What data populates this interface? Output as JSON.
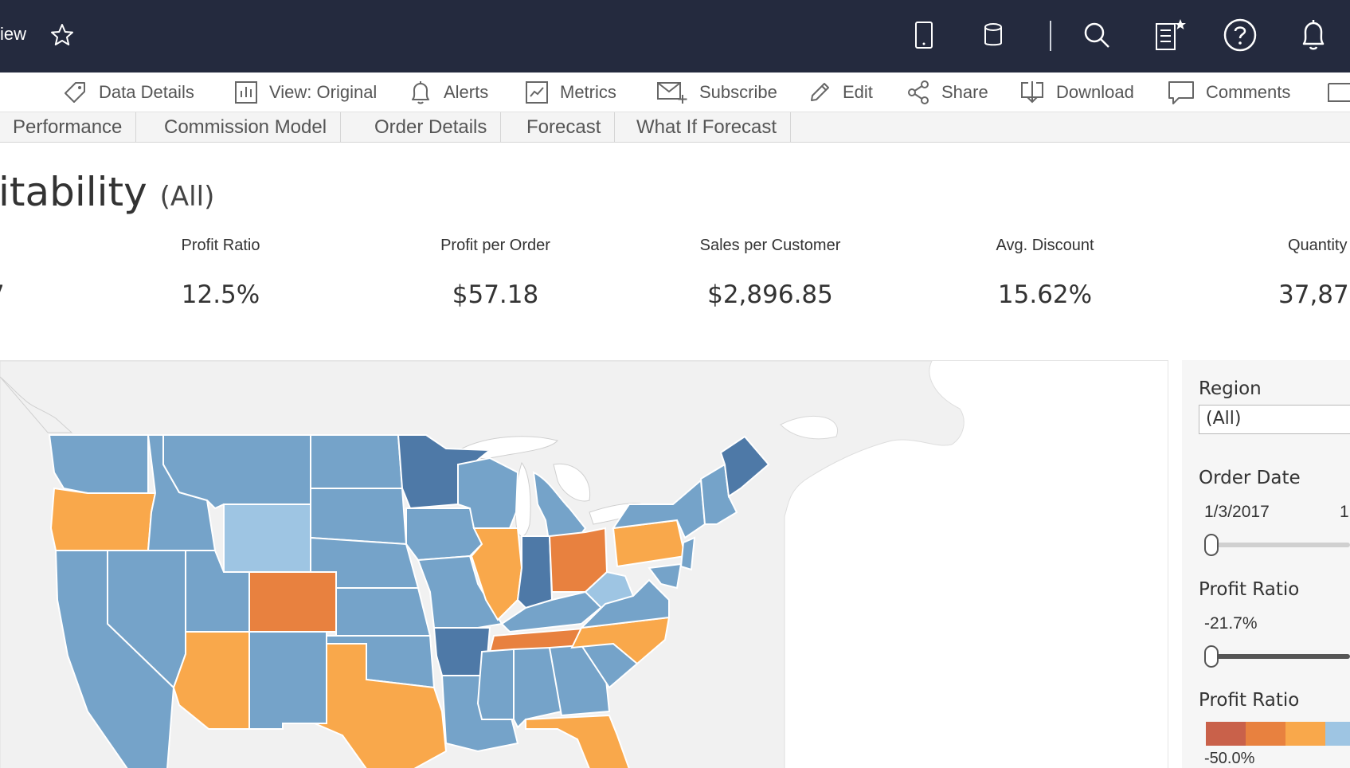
{
  "app": {
    "title_fragment": "iew"
  },
  "toolbar": {
    "items": [
      {
        "label": "Data Details",
        "icon": "tag-icon"
      },
      {
        "label": "View: Original",
        "icon": "bar-chart-icon"
      },
      {
        "label": "Alerts",
        "icon": "bell-icon"
      },
      {
        "label": "Metrics",
        "icon": "metrics-icon"
      },
      {
        "label": "Subscribe",
        "icon": "mail-plus-icon"
      },
      {
        "label": "Edit",
        "icon": "pencil-icon"
      },
      {
        "label": "Share",
        "icon": "share-icon"
      },
      {
        "label": "Download",
        "icon": "download-icon"
      },
      {
        "label": "Comments",
        "icon": "comment-icon"
      }
    ]
  },
  "tabs": [
    "Performance",
    "Commission Model",
    "Order Details",
    "Forecast",
    "What If Forecast"
  ],
  "dashboard": {
    "title": "itability",
    "title_suffix": "(All)"
  },
  "kpis": [
    {
      "label": "Profit Ratio",
      "value": "12.5%"
    },
    {
      "label": "Profit per Order",
      "value": "$57.18"
    },
    {
      "label": "Sales per Customer",
      "value": "$2,896.85"
    },
    {
      "label": "Avg. Discount",
      "value": "15.62%"
    }
  ],
  "kpi_left_value_fragment": "7",
  "kpi_edge": {
    "label": "Quantity",
    "value": "37,87"
  },
  "filters": {
    "region_title": "Region",
    "region_value": "(All)",
    "order_date_title": "Order Date",
    "order_date_start": "1/3/2017",
    "order_date_end_fragment": "1",
    "profit_ratio_title": "Profit Ratio",
    "profit_ratio_min": "-21.7%",
    "profit_ratio_legend_title": "Profit Ratio",
    "legend_min_label": "-50.0%"
  },
  "colors": {
    "topbar_bg": "#242a3e",
    "profit_high": "#4e79a7",
    "profit_mid": "#75a3c9",
    "profit_light": "#9ec5e3",
    "loss_light": "#f9a84b",
    "loss_mid": "#e8813f",
    "loss_dark": "#c9614a"
  },
  "map_states": [
    {
      "state": "WA",
      "level": "profit_mid"
    },
    {
      "state": "OR",
      "level": "loss_light"
    },
    {
      "state": "CA",
      "level": "profit_mid"
    },
    {
      "state": "ID",
      "level": "profit_mid"
    },
    {
      "state": "NV",
      "level": "profit_mid"
    },
    {
      "state": "MT",
      "level": "profit_mid"
    },
    {
      "state": "WY",
      "level": "profit_light"
    },
    {
      "state": "UT",
      "level": "profit_mid"
    },
    {
      "state": "AZ",
      "level": "loss_light"
    },
    {
      "state": "CO",
      "level": "loss_mid"
    },
    {
      "state": "NM",
      "level": "profit_mid"
    },
    {
      "state": "ND",
      "level": "profit_mid"
    },
    {
      "state": "SD",
      "level": "profit_mid"
    },
    {
      "state": "NE",
      "level": "profit_mid"
    },
    {
      "state": "KS",
      "level": "profit_mid"
    },
    {
      "state": "OK",
      "level": "profit_mid"
    },
    {
      "state": "TX",
      "level": "loss_light"
    },
    {
      "state": "MN",
      "level": "profit_high"
    },
    {
      "state": "IA",
      "level": "profit_mid"
    },
    {
      "state": "MO",
      "level": "profit_mid"
    },
    {
      "state": "AR",
      "level": "profit_high"
    },
    {
      "state": "LA",
      "level": "profit_mid"
    },
    {
      "state": "WI",
      "level": "profit_mid"
    },
    {
      "state": "IL",
      "level": "loss_light"
    },
    {
      "state": "MI",
      "level": "profit_mid"
    },
    {
      "state": "IN",
      "level": "profit_high"
    },
    {
      "state": "OH",
      "level": "loss_mid"
    },
    {
      "state": "KY",
      "level": "profit_mid"
    },
    {
      "state": "TN",
      "level": "loss_mid"
    },
    {
      "state": "MS",
      "level": "profit_mid"
    },
    {
      "state": "AL",
      "level": "profit_mid"
    },
    {
      "state": "GA",
      "level": "profit_mid"
    },
    {
      "state": "FL",
      "level": "loss_light"
    },
    {
      "state": "SC",
      "level": "profit_mid"
    },
    {
      "state": "NC",
      "level": "loss_light"
    },
    {
      "state": "VA",
      "level": "profit_mid"
    },
    {
      "state": "WV",
      "level": "profit_light"
    },
    {
      "state": "PA",
      "level": "loss_light"
    },
    {
      "state": "NY",
      "level": "profit_mid"
    },
    {
      "state": "ME",
      "level": "profit_high"
    },
    {
      "state": "NE-states",
      "level": "profit_mid"
    }
  ]
}
